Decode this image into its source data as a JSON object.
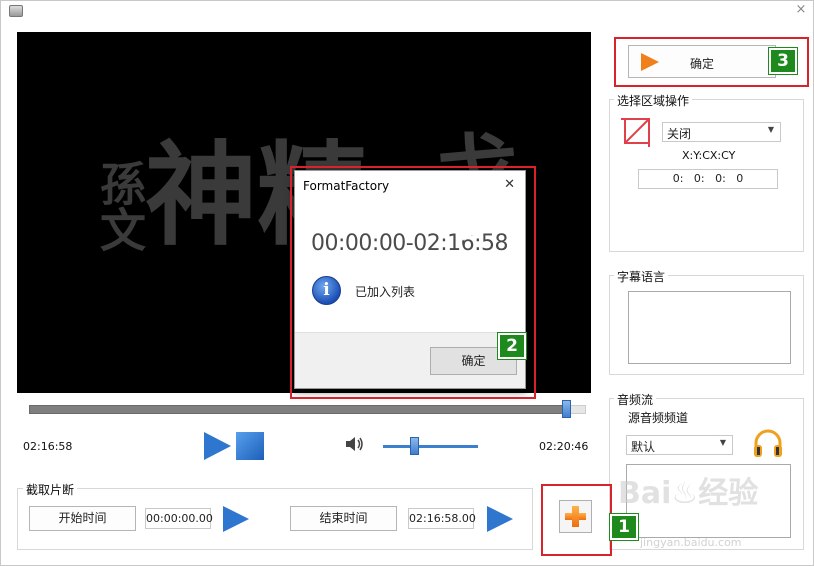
{
  "window": {
    "close_glyph": "×"
  },
  "video": {
    "calligraphy_main": "神精",
    "calligraphy_seal": "孫文",
    "calligraphy_extra": "戈"
  },
  "dialog": {
    "title": "FormatFactory",
    "close_glyph": "✕",
    "time_range": "00:00:00-02:16:58",
    "info_glyph": "i",
    "message": "已加入列表",
    "ok_label": "确定"
  },
  "playback": {
    "current_time": "02:16:58",
    "total_time": "02:20:46",
    "progress_fraction": 0.96,
    "volume_fraction": 0.3
  },
  "clip": {
    "group_title": "截取片断",
    "start_button": "开始时间",
    "start_value": "00:00:00.00",
    "end_button": "结束时间",
    "end_value": "02:16:58.00"
  },
  "right_panel": {
    "ok_label": "确定",
    "region_group_title": "选择区域操作",
    "region_select_value": "关闭",
    "coords_label": "X:Y:CX:CY",
    "coords_value": "0:   0:   0:   0",
    "subtitle_group_title": "字幕语言",
    "audio_group_title": "音频流",
    "audio_channel_label": "源音频频道",
    "audio_select_value": "默认"
  },
  "annotations": {
    "badge_1": "1",
    "badge_2": "2",
    "badge_3": "3",
    "color": "#d8232a",
    "badge_color": "#1e8a1e"
  },
  "watermark": {
    "text": "Bai♨经验",
    "sub": "jingyan.baidu.com"
  },
  "colors": {
    "accent": "#2f76cf",
    "orange": "#f0801a"
  }
}
